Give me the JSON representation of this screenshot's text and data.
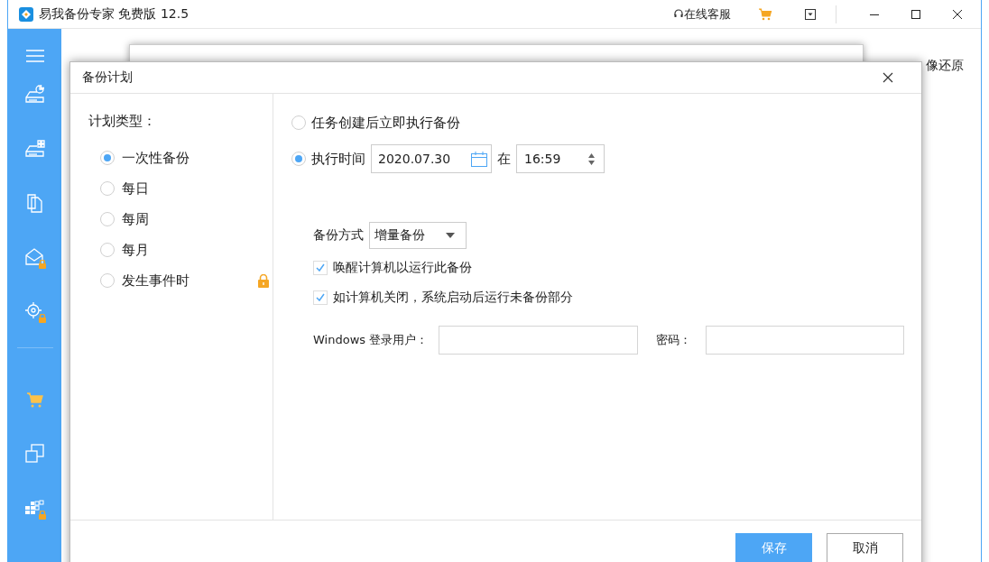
{
  "window": {
    "title": "易我备份专家 免费版 12.5",
    "support": "在线客服"
  },
  "sidebar": {
    "items": [
      {
        "kind": "drive-pie",
        "locked": false
      },
      {
        "kind": "drive-grid",
        "locked": false
      },
      {
        "kind": "files",
        "locked": false
      },
      {
        "kind": "mail",
        "locked": true
      },
      {
        "kind": "target",
        "locked": true
      },
      {
        "kind": "cart",
        "locked": false
      },
      {
        "kind": "clone",
        "locked": false
      },
      {
        "kind": "tiles",
        "locked": true
      }
    ]
  },
  "background": {
    "text": "像还原"
  },
  "dialog": {
    "title": "备份计划",
    "plan_type_label": "计划类型：",
    "plan_types": [
      {
        "label": "一次性备份",
        "selected": true,
        "locked": false
      },
      {
        "label": "每日",
        "selected": false,
        "locked": false
      },
      {
        "label": "每周",
        "selected": false,
        "locked": false
      },
      {
        "label": "每月",
        "selected": false,
        "locked": false
      },
      {
        "label": "发生事件时",
        "selected": false,
        "locked": true
      }
    ],
    "run_options": [
      {
        "kind": "immediate",
        "label": "任务创建后立即执行备份",
        "selected": false
      },
      {
        "kind": "scheduled",
        "label": "执行时间",
        "selected": true,
        "date": "2020.07.30",
        "at": "在",
        "time": "16:59"
      }
    ],
    "backup_mode": {
      "label": "备份方式",
      "value": "增量备份"
    },
    "options": [
      {
        "label": "唤醒计算机以运行此备份",
        "checked": true
      },
      {
        "label": "如计算机关闭，系统启动后运行未备份部分",
        "checked": true
      }
    ],
    "login": {
      "user_label": "Windows 登录用户：",
      "password_label": "密码："
    },
    "buttons": [
      {
        "label": "保存",
        "kind": "primary"
      },
      {
        "label": "取消",
        "kind": "secondary"
      }
    ]
  }
}
